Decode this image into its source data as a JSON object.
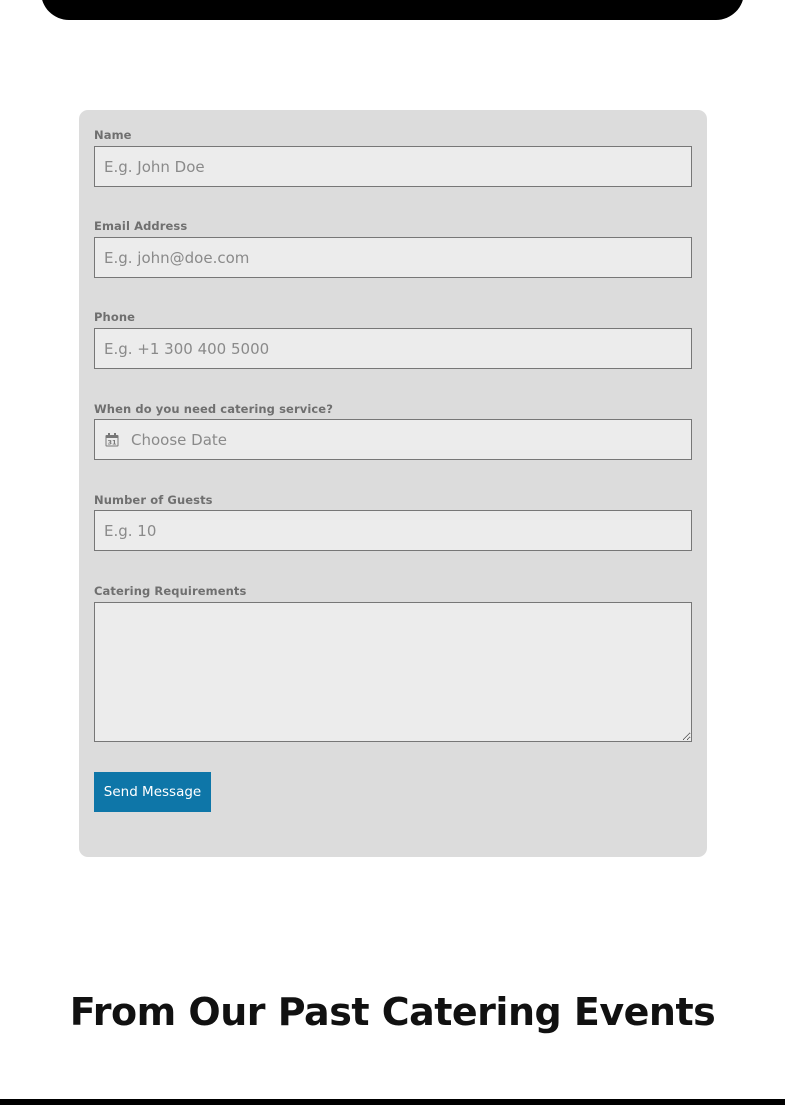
{
  "form": {
    "name": {
      "label": "Name",
      "placeholder": "E.g. John Doe",
      "value": ""
    },
    "email": {
      "label": "Email Address",
      "placeholder": "E.g. john@doe.com",
      "value": ""
    },
    "phone": {
      "label": "Phone",
      "placeholder": "E.g. +1 300 400 5000",
      "value": ""
    },
    "date": {
      "label": "When do you need catering service?",
      "placeholder": "Choose Date",
      "icon": "calendar-icon",
      "icon_day": "31",
      "value": ""
    },
    "guests": {
      "label": "Number of Guests",
      "placeholder": "E.g. 10",
      "value": ""
    },
    "requirements": {
      "label": "Catering Requirements",
      "value": ""
    },
    "submit_label": "Send Message"
  },
  "gallery": {
    "heading": "From Our Past Catering Events"
  },
  "colors": {
    "form_background": "#dcdcdc",
    "input_background": "#ececec",
    "button_background": "#0e76a8",
    "label_color": "#6f6f6f"
  }
}
